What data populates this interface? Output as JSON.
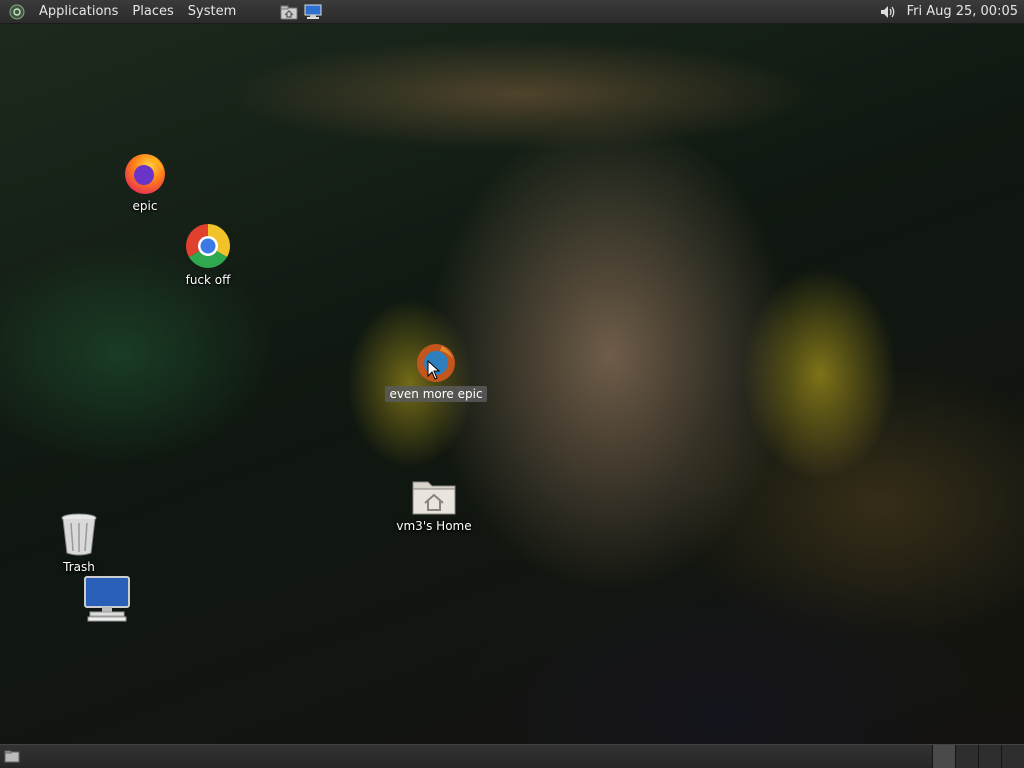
{
  "top_panel": {
    "menus": [
      "Applications",
      "Places",
      "System"
    ],
    "launchers": [
      "home-folder-launcher",
      "show-desktop-launcher"
    ],
    "volume_icon": "volume-icon",
    "clock": "Fri Aug 25, 00:05"
  },
  "desktop": {
    "icons": [
      {
        "label": "epic",
        "icon": "firefox-icon"
      },
      {
        "label": "fuck off",
        "icon": "chrome-icon"
      },
      {
        "label": "even more epic",
        "icon": "firefox-icon",
        "selected": true
      },
      {
        "label": "vm3's Home",
        "icon": "home-folder-icon"
      },
      {
        "label": "Trash",
        "icon": "trash-icon"
      },
      {
        "label": "",
        "icon": "computer-icon"
      }
    ]
  },
  "bottom_panel": {
    "show_desktop_icon": "show-desktop-icon",
    "workspaces": 4,
    "active_workspace": 1
  },
  "colors": {
    "panel": "#2b2b2b",
    "selection": "#5a5a5a",
    "workspace_active": "#4a4a4a"
  }
}
